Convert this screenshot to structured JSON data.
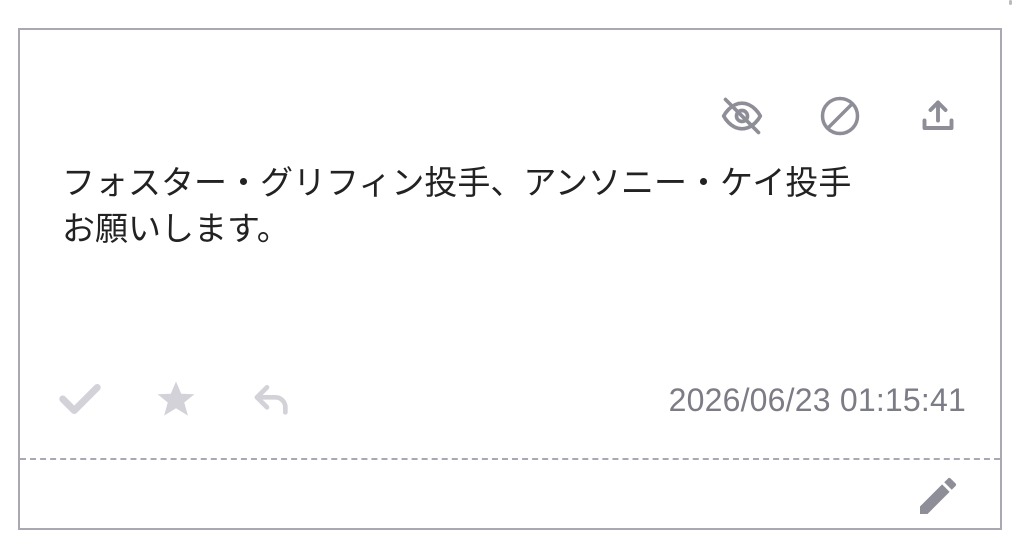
{
  "message": {
    "line1": "フォスター・グリフィン投手、アンソニー・ケイ投手",
    "line2": "お願いします。"
  },
  "timestamp": "2026/06/23 01:15:41",
  "icons": {
    "hide": "eye-off-icon",
    "block": "block-icon",
    "share": "upload-icon",
    "check": "check-icon",
    "star": "star-icon",
    "reply": "reply-icon",
    "edit": "pencil-icon"
  },
  "colors": {
    "icon_dark": "#8e8e98",
    "icon_light": "#d2d2d8",
    "border": "#a9a9b3",
    "text": "#222222",
    "timestamp": "#7c7c86"
  }
}
